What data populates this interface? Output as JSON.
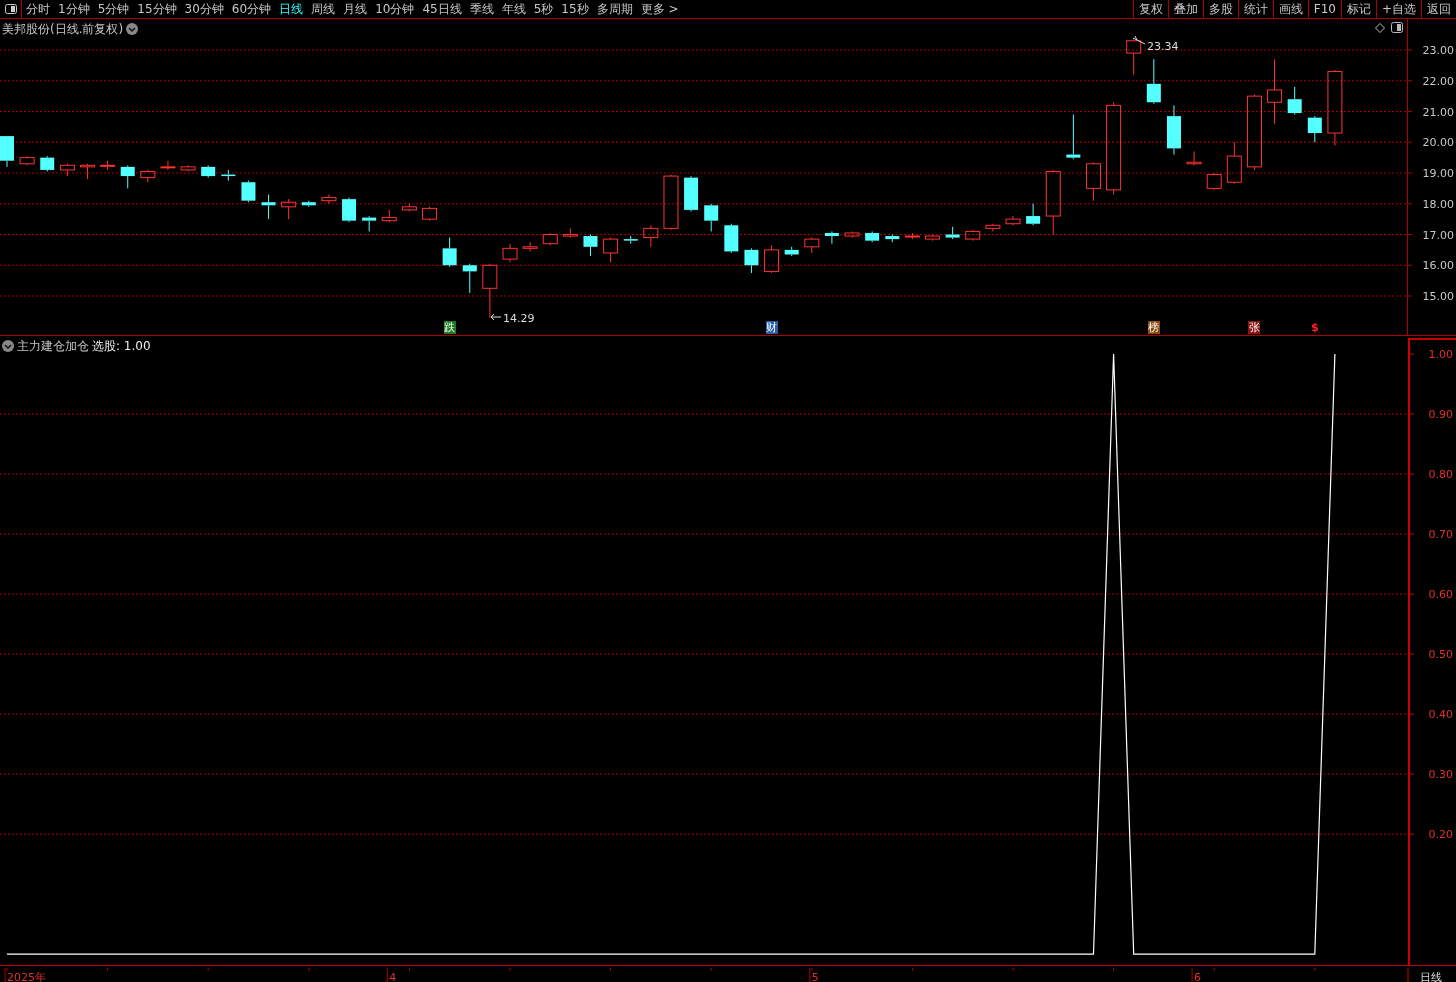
{
  "toolbar": {
    "periods": [
      {
        "label": "分时",
        "selected": false
      },
      {
        "label": "1分钟",
        "selected": false
      },
      {
        "label": "5分钟",
        "selected": false
      },
      {
        "label": "15分钟",
        "selected": false
      },
      {
        "label": "30分钟",
        "selected": false
      },
      {
        "label": "60分钟",
        "selected": false
      },
      {
        "label": "日线",
        "selected": true
      },
      {
        "label": "周线",
        "selected": false
      },
      {
        "label": "月线",
        "selected": false
      },
      {
        "label": "10分钟",
        "selected": false
      },
      {
        "label": "45日线",
        "selected": false
      },
      {
        "label": "季线",
        "selected": false
      },
      {
        "label": "年线",
        "selected": false
      },
      {
        "label": "5秒",
        "selected": false
      },
      {
        "label": "15秒",
        "selected": false
      },
      {
        "label": "多周期",
        "selected": false
      },
      {
        "label": "更多 >",
        "selected": false
      }
    ],
    "actions": [
      "复权",
      "叠加",
      "多股",
      "统计",
      "画线",
      "F10",
      "标记",
      "+自选",
      "返回"
    ]
  },
  "price_chart": {
    "title": "美邦股份(日线.前复权)",
    "axis_labels": [
      "23.00",
      "22.00",
      "21.00",
      "20.00",
      "19.00",
      "18.00",
      "17.00",
      "16.00",
      "15.00"
    ],
    "high_label": "23.34",
    "low_label": "14.29",
    "events": [
      {
        "kind": "tag",
        "text": "跌",
        "color": "#1f7a1f"
      },
      {
        "kind": "tag",
        "text": "财",
        "color": "#2a5fa8"
      },
      {
        "kind": "tag",
        "text": "榜",
        "color": "#8a4b12"
      },
      {
        "kind": "tag",
        "text": "张",
        "color": "#8c1414"
      },
      {
        "kind": "flag",
        "text": "$",
        "color": "#ff2020"
      }
    ]
  },
  "indicator": {
    "name": "主力建仓加仓",
    "output": "选股: 1.00",
    "chart_data": {
      "type": "line",
      "grid": true,
      "ylim": [
        -0.018,
        1.03
      ],
      "yticks": [
        {
          "value": 1.0,
          "label": "1.00"
        },
        {
          "value": 0.9,
          "label": "0.90"
        },
        {
          "value": 0.8,
          "label": "0.80"
        },
        {
          "value": 0.7,
          "label": "0.70"
        },
        {
          "value": 0.6,
          "label": "0.60"
        },
        {
          "value": 0.5,
          "label": "0.50"
        },
        {
          "value": 0.4,
          "label": "0.40"
        },
        {
          "value": 0.3,
          "label": "0.30"
        },
        {
          "value": 0.2,
          "label": "0.20"
        }
      ],
      "series": [
        {
          "color": "#ffffff",
          "values": [
            0,
            0,
            0,
            0,
            0,
            0,
            0,
            0,
            0,
            0,
            0,
            0,
            0,
            0,
            0,
            0,
            0,
            0,
            0,
            0,
            0,
            0,
            0,
            0,
            0,
            0,
            0,
            0,
            0,
            0,
            0,
            0,
            0,
            0,
            0,
            0,
            0,
            0,
            0,
            0,
            0,
            0,
            0,
            0,
            0,
            0,
            0,
            0,
            0,
            0,
            0,
            0,
            0,
            0,
            0,
            1,
            0,
            0,
            0,
            0,
            0,
            0,
            0,
            0,
            0,
            0,
            1
          ]
        }
      ]
    }
  },
  "x_axis": {
    "labels": [
      "2025年",
      "4",
      "5",
      "6"
    ],
    "period": "日线"
  }
}
